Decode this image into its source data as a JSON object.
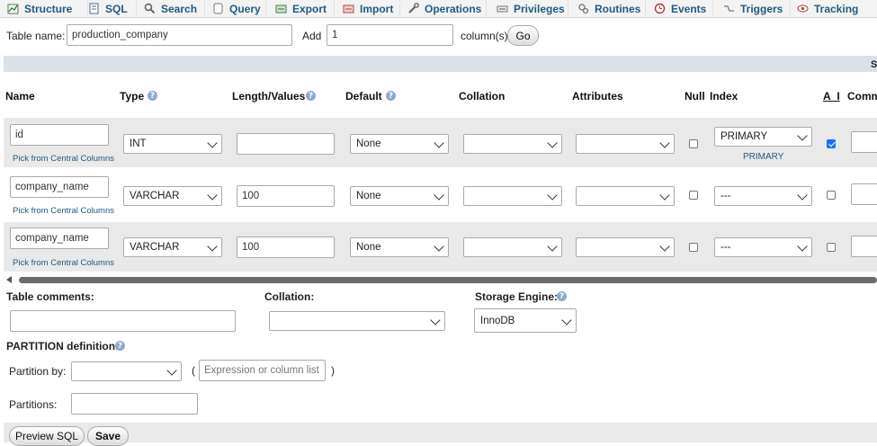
{
  "nav": {
    "tabs": [
      {
        "label": "Structure",
        "icon": "structure-icon"
      },
      {
        "label": "SQL",
        "icon": "sql-icon"
      },
      {
        "label": "Search",
        "icon": "search-icon"
      },
      {
        "label": "Query",
        "icon": "query-icon"
      },
      {
        "label": "Export",
        "icon": "export-icon"
      },
      {
        "label": "Import",
        "icon": "import-icon"
      },
      {
        "label": "Operations",
        "icon": "wrench-icon"
      },
      {
        "label": "Privileges",
        "icon": "privileges-icon"
      },
      {
        "label": "Routines",
        "icon": "routines-icon"
      },
      {
        "label": "Events",
        "icon": "clock-icon"
      },
      {
        "label": "Triggers",
        "icon": "triggers-icon"
      },
      {
        "label": "Tracking",
        "icon": "eye-icon"
      }
    ]
  },
  "table_form": {
    "table_name_label": "Table name:",
    "table_name_value": "production_company",
    "add_label": "Add",
    "add_value": "1",
    "columns_label": "column(s)",
    "go_button": "Go",
    "right_cut_label": "S"
  },
  "columns_header": {
    "name": "Name",
    "type": "Type",
    "length": "Length/Values",
    "default": "Default",
    "collation": "Collation",
    "attributes": "Attributes",
    "null": "Null",
    "index": "Index",
    "ai": "A_I",
    "comments": "Comm"
  },
  "rows": [
    {
      "name": "id",
      "type": "INT",
      "length": "",
      "default": "None",
      "collation": "",
      "attributes": "",
      "null": false,
      "index": "PRIMARY",
      "index_note": "PRIMARY",
      "ai": true,
      "pick": "Pick from Central Columns"
    },
    {
      "name": "company_name",
      "type": "VARCHAR",
      "length": "100",
      "default": "None",
      "collation": "",
      "attributes": "",
      "null": false,
      "index": "---",
      "index_note": "",
      "ai": false,
      "pick": "Pick from Central Columns"
    },
    {
      "name": "company_name",
      "type": "VARCHAR",
      "length": "100",
      "default": "None",
      "collation": "",
      "attributes": "",
      "null": false,
      "index": "---",
      "index_note": "",
      "ai": false,
      "pick": "Pick from Central Columns"
    }
  ],
  "table_options": {
    "comments_label": "Table comments:",
    "comments_value": "",
    "collation_label": "Collation:",
    "collation_value": "",
    "engine_label": "Storage Engine:",
    "engine_value": "InnoDB"
  },
  "partition": {
    "title": "PARTITION definition:",
    "by_label": "Partition by:",
    "by_value": "",
    "open_paren": "(",
    "close_paren": ")",
    "expression_placeholder": "Expression or column list",
    "partitions_label": "Partitions:",
    "partitions_value": ""
  },
  "footer": {
    "preview_button": "Preview SQL",
    "save_button": "Save"
  },
  "colors": {
    "link": "#235a81",
    "row_bg": "#e9e9e9",
    "band": "#d9e1ea",
    "checkbox_on": "#1a73e8"
  }
}
